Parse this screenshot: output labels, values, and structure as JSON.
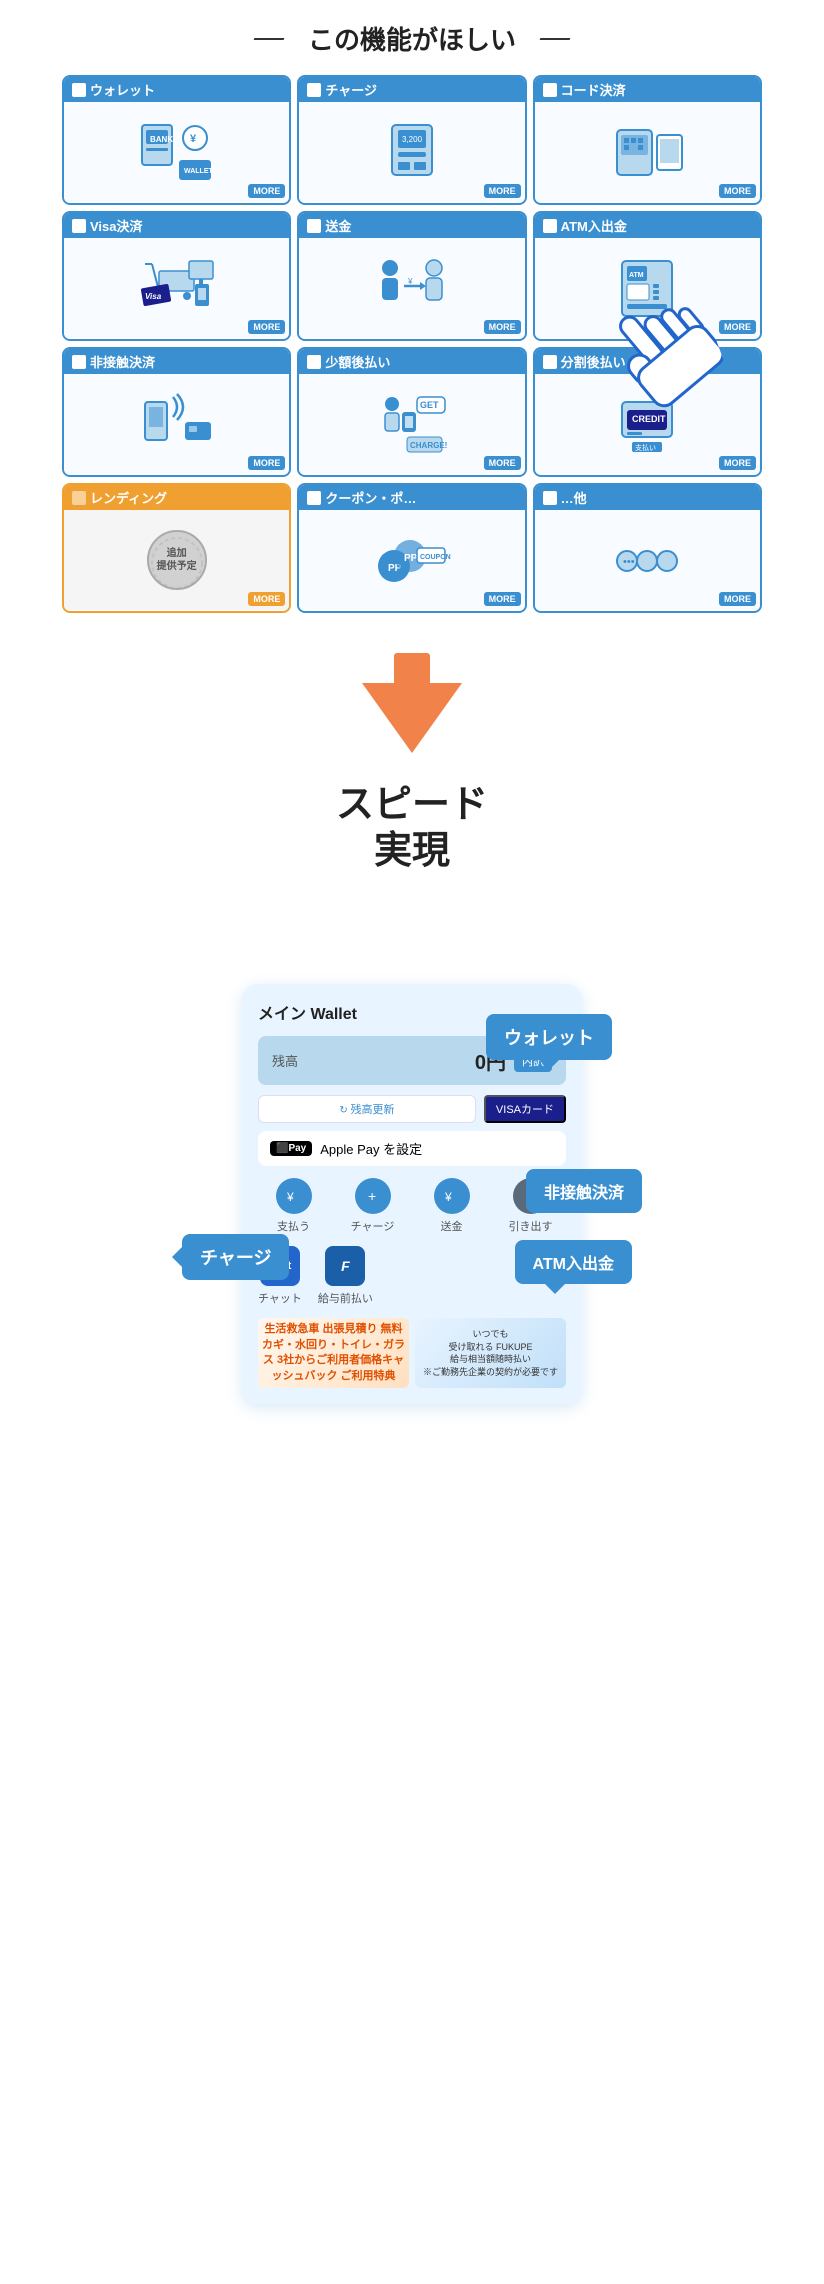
{
  "page": {
    "topTitle": "この機能がほしい",
    "speedTitle": "スピード\n実現",
    "tiles": [
      {
        "id": "wallet",
        "label": "ウォレット",
        "more": "MORE",
        "type": "active",
        "icon": "💳",
        "row": 1
      },
      {
        "id": "charge",
        "label": "チャージ",
        "more": "MORE",
        "type": "active",
        "icon": "🏧",
        "row": 1
      },
      {
        "id": "code-pay",
        "label": "コード決済",
        "more": "MORE",
        "type": "active",
        "icon": "📱",
        "row": 1
      },
      {
        "id": "visa-pay",
        "label": "Visa決済",
        "more": "MORE",
        "type": "active",
        "icon": "💳",
        "row": 2
      },
      {
        "id": "transfer",
        "label": "送金",
        "more": "MORE",
        "type": "active",
        "icon": "👤",
        "row": 2
      },
      {
        "id": "atm",
        "label": "ATM入出金",
        "more": "MORE",
        "type": "active",
        "icon": "🏧",
        "row": 2
      },
      {
        "id": "contactless",
        "label": "非接触決済",
        "more": "MORE",
        "type": "active",
        "icon": "📲",
        "row": 3
      },
      {
        "id": "buy-now",
        "label": "少額後払い",
        "more": "MORE",
        "type": "active",
        "icon": "💰",
        "row": 3
      },
      {
        "id": "installment",
        "label": "分割後払い",
        "more": "MORE",
        "type": "active",
        "icon": "💳",
        "row": 3
      },
      {
        "id": "lending",
        "label": "レンディング",
        "more": "MORE",
        "type": "pending",
        "icon": "🏦",
        "row": 4
      },
      {
        "id": "coupon",
        "label": "クーポン・ポ…",
        "more": "MORE",
        "type": "active",
        "icon": "🎟",
        "row": 4
      },
      {
        "id": "other",
        "label": "…他",
        "more": "MORE",
        "type": "active",
        "icon": "➕",
        "row": 4
      }
    ],
    "pendingText": "追加\n提供予定",
    "appMockup": {
      "headerLabel": "メイン Wallet",
      "balanceLabel": "残高",
      "balanceValue": "0円",
      "balanceDetailBtn": "内訳",
      "refreshLabel": "残高更新",
      "visaLabel": "VISAカード",
      "applePayLabel": "Apple Pay を設定",
      "quickActions": [
        {
          "id": "pay",
          "label": "支払う",
          "icon": "¥"
        },
        {
          "id": "charge-action",
          "label": "チャージ",
          "icon": "+"
        },
        {
          "id": "send",
          "label": "送金",
          "icon": "¥"
        },
        {
          "id": "withdraw",
          "label": "引き出す",
          "icon": "↑"
        }
      ],
      "services": [
        {
          "id": "chat",
          "label": "チャット",
          "icon": "chat"
        },
        {
          "id": "fukupe",
          "label": "給与前払い",
          "icon": "F"
        }
      ],
      "callouts": [
        {
          "id": "wallet-callout",
          "text": "ウォレット"
        },
        {
          "id": "contactless-callout",
          "text": "非接触決済"
        },
        {
          "id": "charge-callout",
          "text": "チャージ"
        },
        {
          "id": "atm-callout",
          "text": "ATM入出金"
        }
      ],
      "banner1Text": "生活救急車 出張見積り 無料\nカギ・水回り・トイレ・ガラス\n3社からご利用者価格キャッシュバック\nご利用特典",
      "banner2Text": "いつでも\n受け取れる FUKUPE\n給与相当額随時払い\n※ご勤務先企業の契約が必要です"
    }
  }
}
